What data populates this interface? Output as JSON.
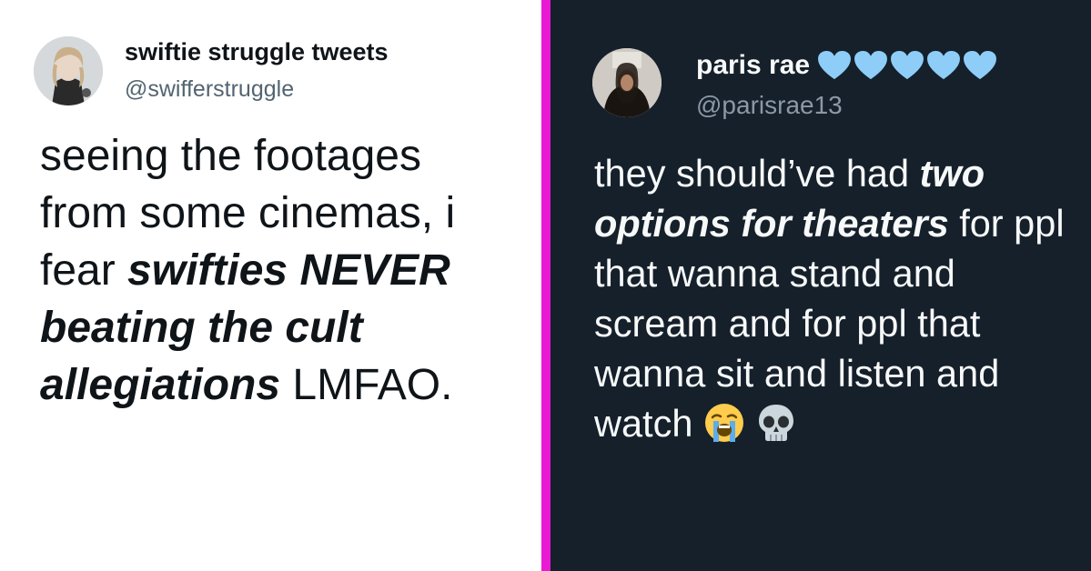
{
  "left_tweet": {
    "name": "swiftie struggle tweets",
    "handle": "@swifferstruggle",
    "text_1": "seeing the footages from some cinemas, i fear ",
    "text_bold": "swifties NEVER beating the cult allegiations",
    "text_2": " LMFAO."
  },
  "right_tweet": {
    "name": "paris rae",
    "name_hearts": [
      "blue-heart",
      "blue-heart",
      "blue-heart",
      "blue-heart",
      "blue-heart"
    ],
    "handle": "@parisrae13",
    "text_1": "they should’ve had ",
    "text_bold": "two options for theaters",
    "text_2": " for ppl that wanna stand and scream and for ppl that wanna sit and listen and watch ",
    "emojis": [
      "loudly-crying-face",
      "skull"
    ]
  },
  "colors": {
    "left_bg": "#ffffff",
    "right_bg": "#15202b",
    "divider": "#e81ad4",
    "heart": "#8ecdf8"
  }
}
